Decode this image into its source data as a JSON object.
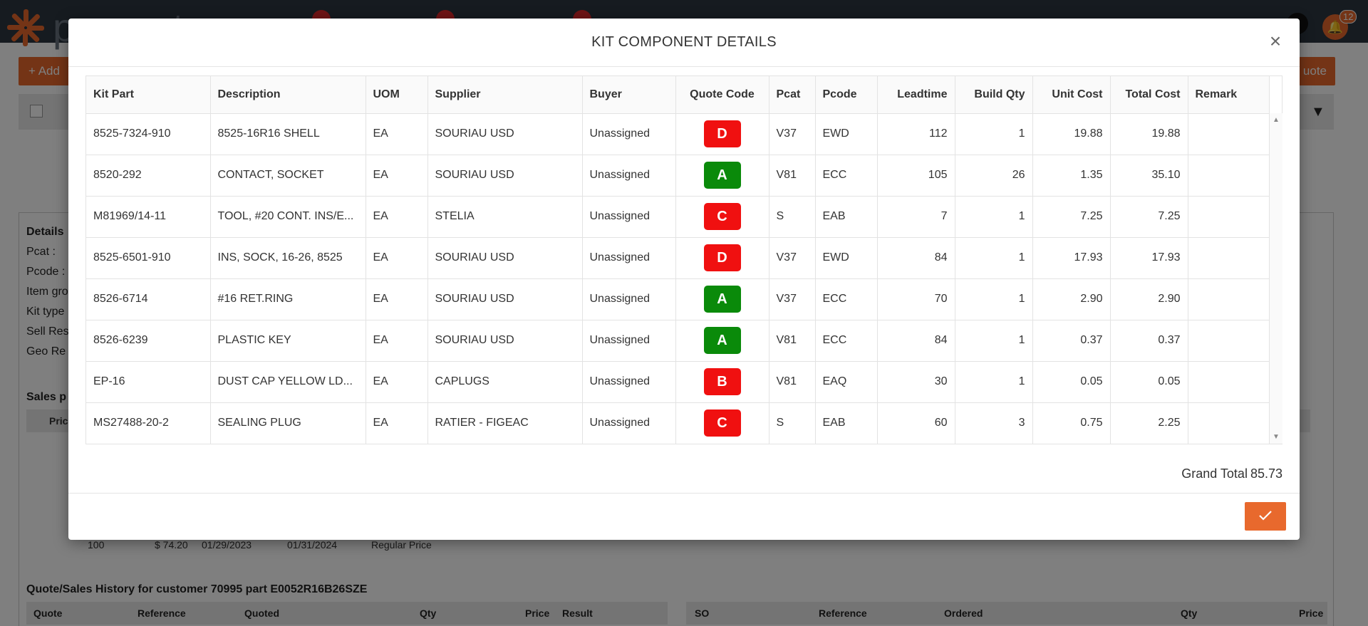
{
  "app": {
    "logo_text": "proquote",
    "notifications_count": "12",
    "add_button": "Add",
    "quote_button": "uote"
  },
  "background": {
    "details_title": "Details",
    "detail_labels": [
      "Pcat :",
      "Pcode :",
      "Item gro",
      "Kit type",
      "Sell Res",
      "Geo Re"
    ],
    "sales_title": "Sales p",
    "sales_head": "Pric",
    "sales_row": [
      "100",
      "$ 74.20",
      "01/29/2023",
      "01/31/2024",
      "Regular Price"
    ],
    "history_title": "Quote/Sales History for customer 70995 part E0052R16B26SZE",
    "history_left_cols": [
      "Quote",
      "Reference",
      "Quoted",
      "Qty",
      "Price",
      "Result"
    ],
    "history_right_cols": [
      "SO",
      "Reference",
      "Ordered",
      "Qty",
      "Price"
    ]
  },
  "modal": {
    "title": "KIT COMPONENT DETAILS",
    "close": "×",
    "columns": [
      "Kit Part",
      "Description",
      "UOM",
      "Supplier",
      "Buyer",
      "Quote Code",
      "Pcat",
      "Pcode",
      "Leadtime",
      "Build Qty",
      "Unit Cost",
      "Total Cost",
      "Remark"
    ],
    "rows": [
      {
        "kit_part": "8525-7324-910",
        "description": "8525-16R16 SHELL",
        "uom": "EA",
        "supplier": "SOURIAU USD",
        "buyer": "Unassigned",
        "quote_code": "D",
        "pcat": "V37",
        "pcode": "EWD",
        "leadtime": "112",
        "build_qty": "1",
        "unit_cost": "19.88",
        "total_cost": "19.88",
        "remark": ""
      },
      {
        "kit_part": "8520-292",
        "description": "CONTACT, SOCKET",
        "uom": "EA",
        "supplier": "SOURIAU USD",
        "buyer": "Unassigned",
        "quote_code": "A",
        "pcat": "V81",
        "pcode": "ECC",
        "leadtime": "105",
        "build_qty": "26",
        "unit_cost": "1.35",
        "total_cost": "35.10",
        "remark": ""
      },
      {
        "kit_part": "M81969/14-11",
        "description": "TOOL, #20 CONT. INS/E...",
        "uom": "EA",
        "supplier": "STELIA",
        "buyer": "Unassigned",
        "quote_code": "C",
        "pcat": "S",
        "pcode": "EAB",
        "leadtime": "7",
        "build_qty": "1",
        "unit_cost": "7.25",
        "total_cost": "7.25",
        "remark": ""
      },
      {
        "kit_part": "8525-6501-910",
        "description": "INS, SOCK, 16-26, 8525",
        "uom": "EA",
        "supplier": "SOURIAU USD",
        "buyer": "Unassigned",
        "quote_code": "D",
        "pcat": "V37",
        "pcode": "EWD",
        "leadtime": "84",
        "build_qty": "1",
        "unit_cost": "17.93",
        "total_cost": "17.93",
        "remark": ""
      },
      {
        "kit_part": "8526-6714",
        "description": "#16 RET.RING",
        "uom": "EA",
        "supplier": "SOURIAU USD",
        "buyer": "Unassigned",
        "quote_code": "A",
        "pcat": "V37",
        "pcode": "ECC",
        "leadtime": "70",
        "build_qty": "1",
        "unit_cost": "2.90",
        "total_cost": "2.90",
        "remark": ""
      },
      {
        "kit_part": "8526-6239",
        "description": "PLASTIC KEY",
        "uom": "EA",
        "supplier": "SOURIAU USD",
        "buyer": "Unassigned",
        "quote_code": "A",
        "pcat": "V81",
        "pcode": "ECC",
        "leadtime": "84",
        "build_qty": "1",
        "unit_cost": "0.37",
        "total_cost": "0.37",
        "remark": ""
      },
      {
        "kit_part": "EP-16",
        "description": "DUST CAP YELLOW LD...",
        "uom": "EA",
        "supplier": "CAPLUGS",
        "buyer": "Unassigned",
        "quote_code": "B",
        "pcat": "V81",
        "pcode": "EAQ",
        "leadtime": "30",
        "build_qty": "1",
        "unit_cost": "0.05",
        "total_cost": "0.05",
        "remark": ""
      },
      {
        "kit_part": "MS27488-20-2",
        "description": "SEALING PLUG",
        "uom": "EA",
        "supplier": "RATIER - FIGEAC",
        "buyer": "Unassigned",
        "quote_code": "C",
        "pcat": "S",
        "pcode": "EAB",
        "leadtime": "60",
        "build_qty": "3",
        "unit_cost": "0.75",
        "total_cost": "2.25",
        "remark": ""
      }
    ],
    "grand_total_label": "Grand Total",
    "grand_total_value": "85.73",
    "ok_icon": "checkmark-icon"
  },
  "colors": {
    "accent": "#e8692d",
    "code_colors": {
      "A": "#0a8a0a",
      "B": "#f01010",
      "C": "#f01010",
      "D": "#f01010"
    }
  }
}
